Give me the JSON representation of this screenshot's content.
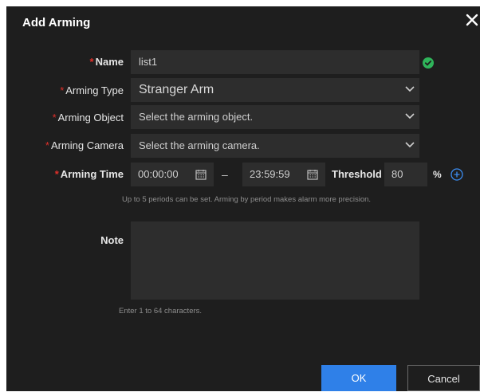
{
  "dialog": {
    "title": "Add Arming",
    "close_icon": "close-icon"
  },
  "form": {
    "required_mark": "*",
    "name": {
      "label": "Name",
      "value": "list1",
      "status_icon": "check-circle-icon"
    },
    "arming_type": {
      "label": "Arming Type",
      "value": "Stranger Arm"
    },
    "arming_object": {
      "label": "Arming Object",
      "value": "Select the arming object."
    },
    "arming_camera": {
      "label": "Arming Camera",
      "value": "Select the arming camera."
    },
    "arming_time": {
      "label": "Arming Time",
      "start": "00:00:00",
      "separator": "–",
      "end": "23:59:59",
      "threshold_label": "Threshold",
      "threshold_value": "80",
      "percent_sign": "%",
      "hint": "Up to 5 periods can be set. Arming by period makes alarm more precision."
    },
    "note": {
      "label": "Note",
      "value": "",
      "hint": "Enter 1 to 64 characters."
    }
  },
  "buttons": {
    "ok": "OK",
    "cancel": "Cancel"
  },
  "colors": {
    "background": "#1e1e1e",
    "field": "#2d2d2d",
    "accent": "#2f80e8",
    "required": "#e0302a",
    "success": "#2fb45a"
  }
}
